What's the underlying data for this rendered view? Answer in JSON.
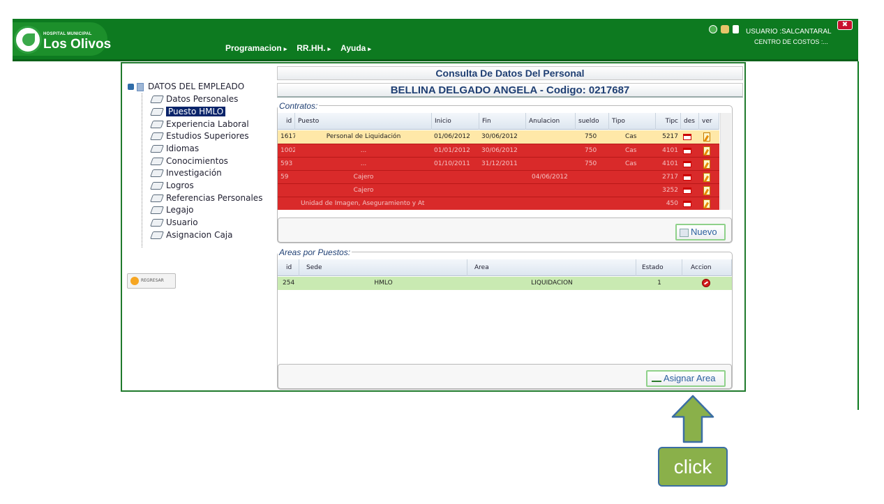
{
  "header": {
    "logo_small": "HOSPITAL MUNICIPAL",
    "logo_big": "Los Olivos",
    "menu": [
      "Programacion",
      "RR.HH.",
      "Ayuda"
    ],
    "user_label": "USUARIO :SALCANTARAL",
    "cost_center": "CENTRO DE COSTOS :...",
    "close_label": "✖",
    "icons": [
      "globe-icon",
      "user-icon",
      "lock-icon"
    ]
  },
  "page": {
    "title": "Consulta De Datos Del Personal",
    "employee": "BELLINA DELGADO ANGELA - Codigo: 0217687"
  },
  "tree": {
    "root": "DATOS DEL EMPLEADO",
    "items": [
      "Datos Personales",
      "Puesto HMLO",
      "Experiencia Laboral",
      "Estudios Superiores",
      "Idiomas",
      "Conocimientos",
      "Investigación",
      "Logros",
      "Referencias Personales",
      "Legajo",
      "Usuario",
      "Asignacion Caja"
    ],
    "selected": "Puesto HMLO"
  },
  "regresar_label": "REGRESAR",
  "contratos": {
    "legend": "Contratos:",
    "columns": [
      "id",
      "Puesto",
      "Inicio",
      "Fin",
      "Anulacion",
      "sueldo",
      "Tipo",
      "Tipc",
      "des",
      "ver"
    ],
    "rows": [
      {
        "id": "1617",
        "puesto": "Personal de Liquidación",
        "inicio": "01/06/2012",
        "fin": "30/06/2012",
        "anulacion": "",
        "sueldo": "750",
        "tipo": "Cas",
        "tipc": "5217",
        "status": "current"
      },
      {
        "id": "1002",
        "puesto": "...",
        "inicio": "01/01/2012",
        "fin": "30/06/2012",
        "anulacion": "",
        "sueldo": "750",
        "tipo": "Cas",
        "tipc": "4101",
        "status": "annulled"
      },
      {
        "id": "593",
        "puesto": "...",
        "inicio": "01/10/2011",
        "fin": "31/12/2011",
        "anulacion": "",
        "sueldo": "750",
        "tipo": "Cas",
        "tipc": "4101",
        "status": "annulled"
      },
      {
        "id": "59",
        "puesto": "Cajero",
        "inicio": "",
        "fin": "",
        "anulacion": "04/06/2012",
        "sueldo": "",
        "tipo": "",
        "tipc": "2717",
        "status": "annulled"
      },
      {
        "id": "",
        "puesto": "Cajero",
        "inicio": "",
        "fin": "",
        "anulacion": "",
        "sueldo": "",
        "tipo": "",
        "tipc": "3252",
        "status": "annulled"
      },
      {
        "id": "",
        "puesto": "Unidad de Imagen, Aseguramiento y At",
        "inicio": "",
        "fin": "",
        "anulacion": "",
        "sueldo": "",
        "tipo": "",
        "tipc": "450",
        "status": "annulled"
      }
    ],
    "new_button": "Nuevo"
  },
  "areas": {
    "legend": "Areas por Puestos:",
    "columns": [
      "id",
      "Sede",
      "Area",
      "Estado",
      "Accion"
    ],
    "rows": [
      {
        "id": "254",
        "sede": "HMLO",
        "area": "LIQUIDACION",
        "estado": "1"
      }
    ],
    "assign_button": "Asignar Area"
  },
  "annotation": {
    "label": "click"
  },
  "colors": {
    "header_green": "#0d7a20",
    "row_current": "#ffe8a8",
    "row_annulled": "#d92a2a",
    "row_area": "#c9eab2",
    "title_blue": "#1f3f73",
    "annotation_fill": "#8ab04a"
  }
}
